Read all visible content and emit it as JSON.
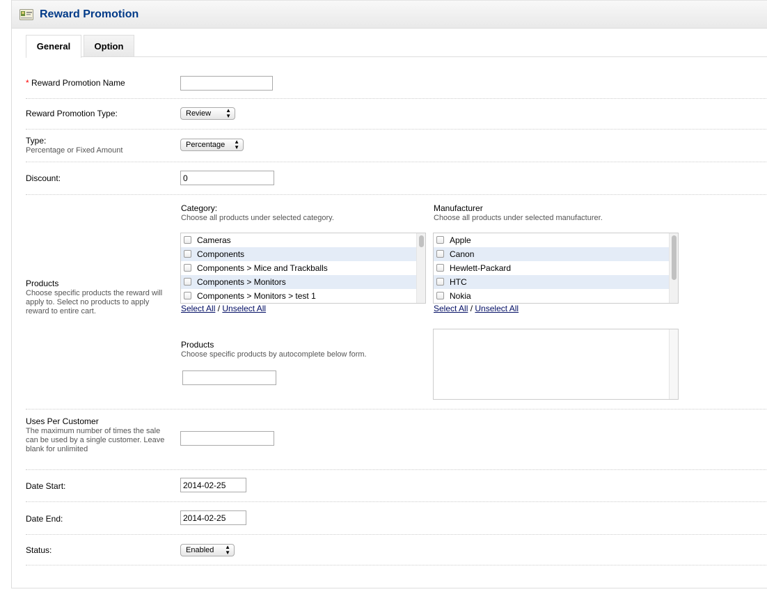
{
  "header": {
    "title": "Reward Promotion",
    "icon": "promotion-card-icon"
  },
  "tabs": [
    {
      "label": "General",
      "active": true
    },
    {
      "label": "Option",
      "active": false
    }
  ],
  "form": {
    "name": {
      "required_mark": "*",
      "label": "Reward Promotion Name",
      "value": ""
    },
    "promo_type": {
      "label": "Reward Promotion Type:",
      "selected": "Review"
    },
    "type": {
      "label": "Type:",
      "help": "Percentage or Fixed Amount",
      "selected": "Percentage"
    },
    "discount": {
      "label": "Discount:",
      "value": "0"
    },
    "products": {
      "label": "Products",
      "help": "Choose specific products the reward will apply to. Select no products to apply reward to entire cart.",
      "category": {
        "label": "Category:",
        "help": "Choose all products under selected category.",
        "items": [
          "Cameras",
          "Components",
          "Components > Mice and Trackballs",
          "Components > Monitors",
          "Components > Monitors > test 1"
        ],
        "select_all": "Select All",
        "sep": "/",
        "unselect_all": "Unselect All"
      },
      "manufacturer": {
        "label": "Manufacturer",
        "help": "Choose all products under selected manufacturer.",
        "items": [
          "Apple",
          "Canon",
          "Hewlett-Packard",
          "HTC",
          "Nokia"
        ],
        "select_all": "Select All",
        "sep": "/",
        "unselect_all": "Unselect All"
      },
      "autocomplete": {
        "label": "Products",
        "help": "Choose specific products by autocomplete below form.",
        "value": ""
      }
    },
    "uses_per_customer": {
      "label": "Uses Per Customer",
      "help": "The maximum number of times the sale can be used by a single customer. Leave blank for unlimited",
      "value": ""
    },
    "date_start": {
      "label": "Date Start:",
      "value": "2014-02-25"
    },
    "date_end": {
      "label": "Date End:",
      "value": "2014-02-25"
    },
    "status": {
      "label": "Status:",
      "selected": "Enabled"
    }
  },
  "colors": {
    "title": "#003a88",
    "link": "#000c63",
    "required": "#ff0000",
    "list_stripe": "#e4ecf7"
  }
}
